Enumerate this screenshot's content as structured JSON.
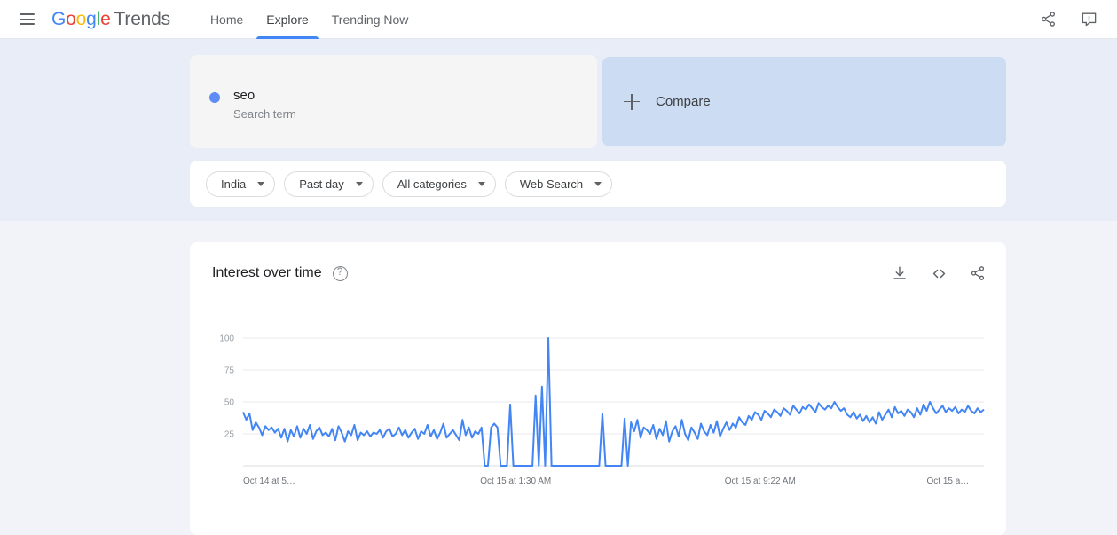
{
  "appbar": {
    "menu_icon": "hamburger-menu-icon",
    "brand": {
      "g1": "G",
      "g2": "o",
      "g3": "o",
      "g4": "g",
      "g5": "l",
      "g6": "e",
      "product": "Trends"
    },
    "tabs": [
      {
        "label": "Home",
        "active": false
      },
      {
        "label": "Explore",
        "active": true
      },
      {
        "label": "Trending Now",
        "active": false
      }
    ],
    "actions": [
      {
        "name": "share-icon",
        "label": "Share"
      },
      {
        "name": "feedback-icon",
        "label": "Send feedback"
      }
    ]
  },
  "query": {
    "term": {
      "label": "seo",
      "subtitle": "Search term",
      "dot_color": "#5e8df5"
    },
    "compare": {
      "label": "Compare",
      "plus_icon": "plus-icon"
    }
  },
  "filters": [
    {
      "label": "India"
    },
    {
      "label": "Past day"
    },
    {
      "label": "All categories"
    },
    {
      "label": "Web Search"
    }
  ],
  "interest_over_time": {
    "title": "Interest over time",
    "help_icon": "help-circle-icon",
    "actions": [
      {
        "name": "download-icon",
        "label": "Download CSV"
      },
      {
        "name": "embed-code-icon",
        "label": "Embed"
      },
      {
        "name": "share-icon",
        "label": "Share"
      }
    ]
  },
  "chart_data": {
    "type": "line",
    "title": "Interest over time",
    "xlabel": "",
    "ylabel": "",
    "ylim": [
      0,
      100
    ],
    "yticks": [
      100,
      75,
      50,
      25
    ],
    "xticks": [
      "Oct 14 at 5…",
      "Oct 15 at 1:30 AM",
      "Oct 15 at 9:22 AM",
      "Oct 15 a…"
    ],
    "xtick_positions": [
      0.0,
      0.32,
      0.65,
      0.98
    ],
    "grid": true,
    "legend": false,
    "series": [
      {
        "name": "seo",
        "color": "#4285f4",
        "values": [
          42,
          36,
          41,
          28,
          34,
          30,
          24,
          31,
          28,
          30,
          26,
          29,
          22,
          29,
          19,
          28,
          23,
          31,
          22,
          29,
          25,
          32,
          21,
          27,
          30,
          24,
          26,
          23,
          29,
          20,
          31,
          26,
          19,
          27,
          24,
          32,
          20,
          26,
          24,
          27,
          23,
          26,
          25,
          28,
          22,
          27,
          29,
          23,
          25,
          30,
          24,
          28,
          22,
          26,
          29,
          21,
          27,
          25,
          32,
          23,
          28,
          21,
          26,
          33,
          22,
          25,
          28,
          24,
          20,
          36,
          24,
          30,
          22,
          27,
          25,
          30,
          0,
          0,
          30,
          33,
          30,
          0,
          0,
          0,
          48,
          0,
          0,
          0,
          0,
          0,
          0,
          0,
          55,
          0,
          62,
          0,
          100,
          0,
          0,
          0,
          0,
          0,
          0,
          0,
          0,
          0,
          0,
          0,
          0,
          0,
          0,
          0,
          0,
          41,
          0,
          0,
          0,
          0,
          0,
          0,
          37,
          0,
          34,
          27,
          36,
          22,
          30,
          28,
          25,
          32,
          21,
          29,
          24,
          35,
          19,
          27,
          31,
          23,
          36,
          25,
          20,
          30,
          26,
          21,
          33,
          27,
          24,
          32,
          26,
          35,
          23,
          29,
          34,
          28,
          33,
          30,
          38,
          34,
          32,
          39,
          36,
          42,
          40,
          36,
          43,
          41,
          38,
          44,
          42,
          39,
          45,
          43,
          40,
          47,
          44,
          41,
          46,
          44,
          48,
          45,
          42,
          49,
          46,
          44,
          47,
          45,
          50,
          46,
          43,
          45,
          40,
          38,
          42,
          37,
          40,
          35,
          39,
          34,
          38,
          33,
          42,
          36,
          40,
          44,
          38,
          46,
          41,
          43,
          39,
          44,
          42,
          38,
          45,
          40,
          48,
          43,
          50,
          45,
          41,
          44,
          47,
          42,
          45,
          43,
          46,
          41,
          44,
          42,
          47,
          43,
          41,
          45,
          42,
          44
        ]
      }
    ]
  }
}
